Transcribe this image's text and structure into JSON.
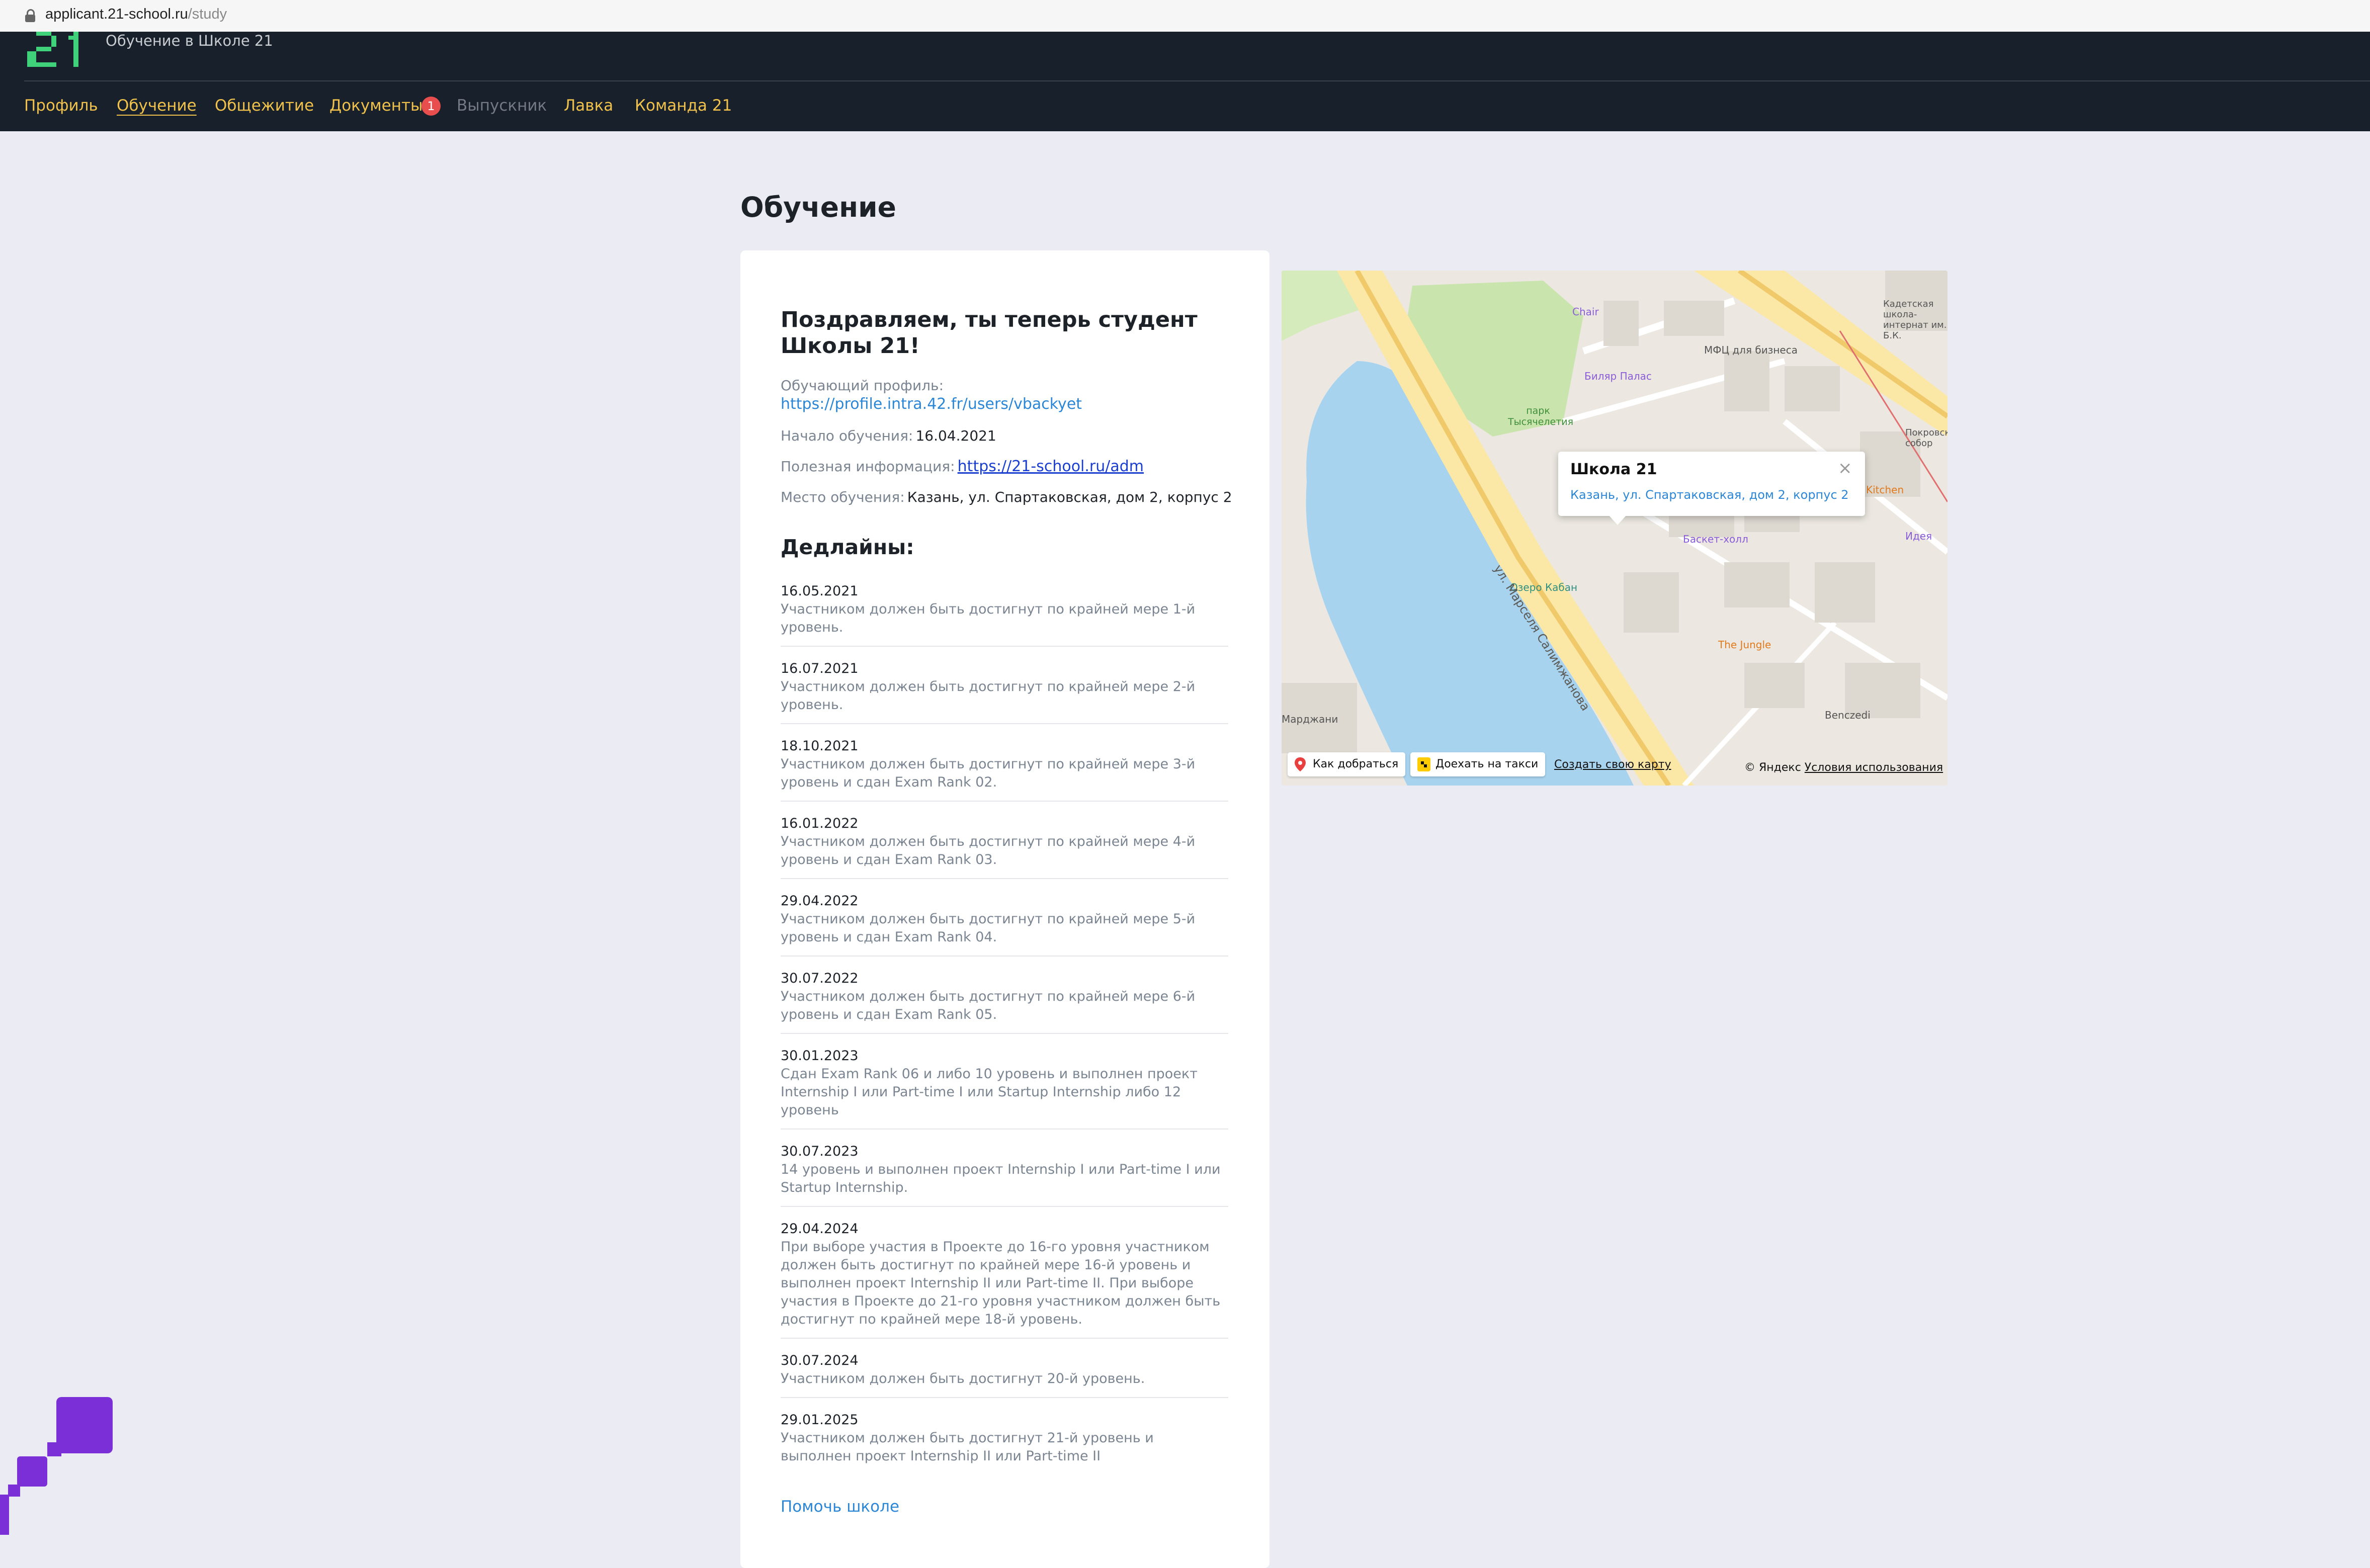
{
  "browser": {
    "url_host": "applicant.21-school.ru",
    "url_path": "/study"
  },
  "header": {
    "logo_caption": "Обучение в Школе 21",
    "nav": [
      {
        "label": "Профиль"
      },
      {
        "label": "Обучение",
        "active": true
      },
      {
        "label": "Общежитие"
      },
      {
        "label": "Документы",
        "badge": "1"
      },
      {
        "label": "Выпускник",
        "disabled": true
      },
      {
        "label": "Лавка"
      },
      {
        "label": "Команда 21"
      }
    ]
  },
  "page": {
    "title": "Обучение"
  },
  "card": {
    "title": "Поздравляем, ты теперь студент Школы 21!",
    "profile_label": "Обучающий профиль:",
    "profile_link": "https://profile.intra.42.fr/users/vbackyet",
    "start_label": "Начало обучения:",
    "start_value": "16.04.2021",
    "useful_label": "Полезная информация:",
    "useful_link": "https://21-school.ru/adm",
    "place_label": "Место обучения:",
    "place_value": "Казань, ул. Спартаковская, дом 2, корпус 2",
    "deadlines_title": "Дедлайны:",
    "deadlines": [
      {
        "date": "16.05.2021",
        "text": "Участником должен быть достигнут по крайней мере 1-й уровень."
      },
      {
        "date": "16.07.2021",
        "text": "Участником должен быть достигнут по крайней мере 2-й уровень."
      },
      {
        "date": "18.10.2021",
        "text": "Участником должен быть достигнут по крайней мере 3-й уровень и сдан Exam Rank 02."
      },
      {
        "date": "16.01.2022",
        "text": "Участником должен быть достигнут по крайней мере 4-й уровень и сдан Exam Rank 03."
      },
      {
        "date": "29.04.2022",
        "text": "Участником должен быть достигнут по крайней мере 5-й уровень и сдан Exam Rank 04."
      },
      {
        "date": "30.07.2022",
        "text": "Участником должен быть достигнут по крайней мере 6-й уровень и сдан Exam Rank 05."
      },
      {
        "date": "30.01.2023",
        "text": "Сдан Exam Rank 06 и либо 10 уровень и выполнен проект Internship I или Part-time I или Startup Internship либо 12 уровень"
      },
      {
        "date": "30.07.2023",
        "text": "14 уровень и выполнен проект Internship I или Part-time I или Startup Internship."
      },
      {
        "date": "29.04.2024",
        "text": "При выборе участия в Проекте до 16-го уровня участником должен быть достигнут по крайней мере 16-й уровень и выполнен проект Internship II или Part-time II. При выборе участия в Проекте до 21-го уровня участником должен быть достигнут по крайней мере 18-й уровень."
      },
      {
        "date": "30.07.2024",
        "text": "Участником должен быть достигнут 20-й уровень."
      },
      {
        "date": "29.01.2025",
        "text": "Участником должен быть достигнут 21-й уровень и выполнен проект Internship II или Part-time II"
      }
    ],
    "help_link": "Помочь школе"
  },
  "map": {
    "popup_title": "Школа 21",
    "popup_address": "Казань, ул. Спартаковская, дом 2, корпус 2",
    "route_button": "Как добраться",
    "taxi_button": "Доехать на такси",
    "create_map_link": "Создать свою карту",
    "copyright": "© Яндекс",
    "terms_link": "Условия использования",
    "street_label": "ул. Марселя Салимжанова",
    "pois": [
      {
        "name": "Chair",
        "color": "#8a5cd8"
      },
      {
        "name": "МФЦ для бизнеса",
        "color": "#555555"
      },
      {
        "name": "Биляр Палас",
        "color": "#8a5cd8"
      },
      {
        "name": "парк Тысячелетия",
        "color": "#3f8f3a"
      },
      {
        "name": "Баскет-холл",
        "color": "#8a5cd8"
      },
      {
        "name": "Озеро Кабан",
        "color": "#2f8f80"
      },
      {
        "name": "The Jungle",
        "color": "#e07a1c"
      },
      {
        "name": "Benczedi",
        "color": "#555555"
      },
      {
        "name": "Идея",
        "color": "#8a5cd8"
      },
      {
        "name": "Покровский собор",
        "color": "#555555"
      },
      {
        "name": "Кадетская школа-интернат им. Б.К.",
        "color": "#555555"
      },
      {
        "name": "Марджани",
        "color": "#555555"
      },
      {
        "name": "Kitchen",
        "color": "#e07a1c"
      }
    ]
  },
  "colors": {
    "nav_bg": "#18202b",
    "nav_link": "#f0c24c",
    "accent_link": "#2b86d6",
    "badge": "#e84e4e",
    "page_bg": "#ebebf3",
    "logo_green": "#3fd27a",
    "deco_purple": "#7b2fd6"
  }
}
